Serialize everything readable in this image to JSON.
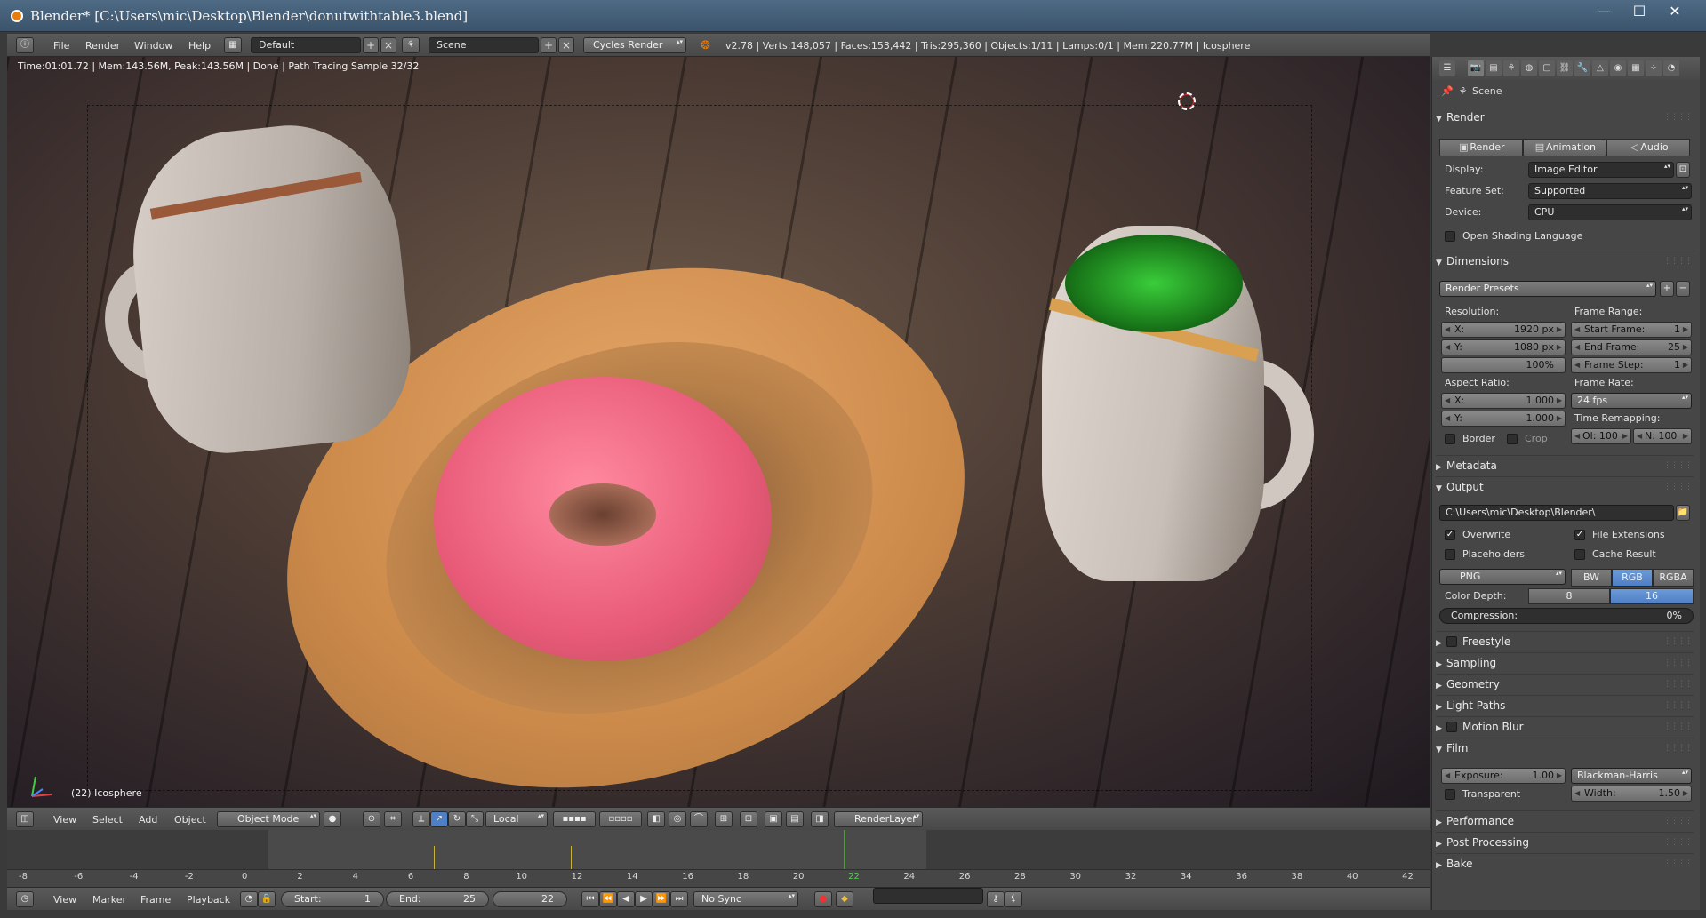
{
  "window": {
    "title": "Blender* [C:\\Users\\mic\\Desktop\\Blender\\donutwithtable3.blend]",
    "minimize": "—",
    "maximize": "☐",
    "close": "✕"
  },
  "info_header": {
    "menus": [
      "File",
      "Render",
      "Window",
      "Help"
    ],
    "layout": "Default",
    "scene": "Scene",
    "engine": "Cycles Render",
    "stats": "v2.78 | Verts:148,057 | Faces:153,442 | Tris:295,360 | Objects:1/11 | Lamps:0/1 | Mem:220.77M | Icosphere"
  },
  "viewport": {
    "render_status": "Time:01:01.72 | Mem:143.56M, Peak:143.56M | Done | Path Tracing Sample 32/32",
    "object_label": "(22) Icosphere"
  },
  "viewport_header": {
    "menus": [
      "View",
      "Select",
      "Add",
      "Object"
    ],
    "mode": "Object Mode",
    "pivot": "Local",
    "render_layer": "RenderLayer"
  },
  "timeline": {
    "ticks": [
      "-8",
      "-6",
      "-4",
      "-2",
      "0",
      "2",
      "4",
      "6",
      "8",
      "10",
      "12",
      "14",
      "16",
      "18",
      "20",
      "22",
      "24",
      "26",
      "28",
      "30",
      "32",
      "34",
      "36",
      "38",
      "40",
      "42"
    ],
    "current_frame_label": "22",
    "menus": [
      "View",
      "Marker",
      "Frame",
      "Playback"
    ],
    "start_label": "Start:",
    "start_value": "1",
    "end_label": "End:",
    "end_value": "25",
    "current_value": "22",
    "sync": "No Sync"
  },
  "properties": {
    "scene_label": "Scene",
    "render": {
      "title": "Render",
      "buttons": [
        "Render",
        "Animation",
        "Audio"
      ],
      "display_label": "Display:",
      "display_value": "Image Editor",
      "feature_label": "Feature Set:",
      "feature_value": "Supported",
      "device_label": "Device:",
      "device_value": "CPU",
      "osl_label": "Open Shading Language"
    },
    "dimensions": {
      "title": "Dimensions",
      "presets": "Render Presets",
      "resolution_label": "Resolution:",
      "res_x_label": "X:",
      "res_x": "1920 px",
      "res_y_label": "Y:",
      "res_y": "1080 px",
      "res_pct": "100%",
      "frame_range_label": "Frame Range:",
      "start_label": "Start Frame:",
      "start": "1",
      "end_label": "End Frame:",
      "end": "25",
      "step_label": "Frame Step:",
      "step": "1",
      "aspect_label": "Aspect Ratio:",
      "aspect_x_label": "X:",
      "aspect_x": "1.000",
      "aspect_y_label": "Y:",
      "aspect_y": "1.000",
      "frame_rate_label": "Frame Rate:",
      "frame_rate": "24 fps",
      "remap_label": "Time Remapping:",
      "remap_old": "Ol: 100",
      "remap_new": "N:  100",
      "border_label": "Border",
      "crop_label": "Crop"
    },
    "metadata_title": "Metadata",
    "output": {
      "title": "Output",
      "path": "C:\\Users\\mic\\Desktop\\Blender\\",
      "overwrite": "Overwrite",
      "file_ext": "File Extensions",
      "placeholders": "Placeholders",
      "cache": "Cache Result",
      "format": "PNG",
      "bw": "BW",
      "rgb": "RGB",
      "rgba": "RGBA",
      "depth_label": "Color Depth:",
      "depth_8": "8",
      "depth_16": "16",
      "compression_label": "Compression:",
      "compression": "0%"
    },
    "collapsed_1": [
      "Freestyle",
      "Sampling",
      "Geometry",
      "Light Paths",
      "Motion Blur"
    ],
    "film": {
      "title": "Film",
      "exposure_label": "Exposure:",
      "exposure": "1.00",
      "filter": "Blackman-Harris",
      "transparent": "Transparent",
      "width_label": "Width:",
      "width": "1.50"
    },
    "collapsed_2": [
      "Performance",
      "Post Processing",
      "Bake"
    ]
  },
  "colors": {
    "accent_blue": "#4f7fc4",
    "current_frame_green": "#4f9a3a",
    "blender_orange": "#e87d0d"
  }
}
